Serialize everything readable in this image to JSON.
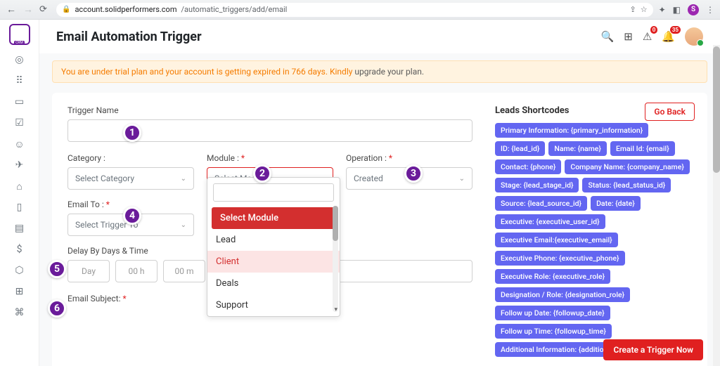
{
  "browser": {
    "url_host": "account.solidperformers.com",
    "url_path": "/automatic_triggers/add/email",
    "avatar_letter": "S"
  },
  "header": {
    "title": "Email Automation Trigger",
    "badge_alert": "0",
    "badge_bell": "35"
  },
  "alert": {
    "text": "You are under trial plan and your account is getting expired in 766 days. Kindly ",
    "link": "upgrade your plan."
  },
  "buttons": {
    "go_back": "Go Back",
    "cta": "Create a Trigger Now"
  },
  "form": {
    "trigger_name_label": "Trigger Name",
    "category_label": "Category :",
    "category_placeholder": "Select Category",
    "module_label": "Module :",
    "module_placeholder": "Select Module",
    "operation_label": "Operation :",
    "operation_value": "Created",
    "email_to_label": "Email To :",
    "email_to_placeholder": "Select Trigger To",
    "delay_label": "Delay By Days & Time",
    "day_ph": "Day",
    "hour_ph": "00 h",
    "min_ph": "00 m",
    "subject_label": "Email Subject:"
  },
  "module_dropdown": {
    "search": "",
    "items": [
      "Select Module",
      "Lead",
      "Client",
      "Deals",
      "Support"
    ]
  },
  "shortcodes": {
    "title": "Leads Shortcodes",
    "chips": [
      "Primary Information: {primary_information}",
      "ID: {lead_id}",
      "Name: {name}",
      "Email Id: {email}",
      "Contact: {phone}",
      "Company Name: {company_name}",
      "Stage: {lead_stage_id}",
      "Status: {lead_status_id}",
      "Source: {lead_source_id}",
      "Date: {date}",
      "Executive: {executive_user_id}",
      "Executive Email:{executive_email}",
      "Executive Phone: {executive_phone}",
      "Executive Role: {executive_role}",
      "Designation / Role: {designation_role}",
      "Follow up Date: {followup_date}",
      "Follow up Time: {followup_time}",
      "Additional Information: {additional_information}"
    ]
  },
  "markers": [
    "1",
    "2",
    "3",
    "4",
    "5",
    "6"
  ]
}
